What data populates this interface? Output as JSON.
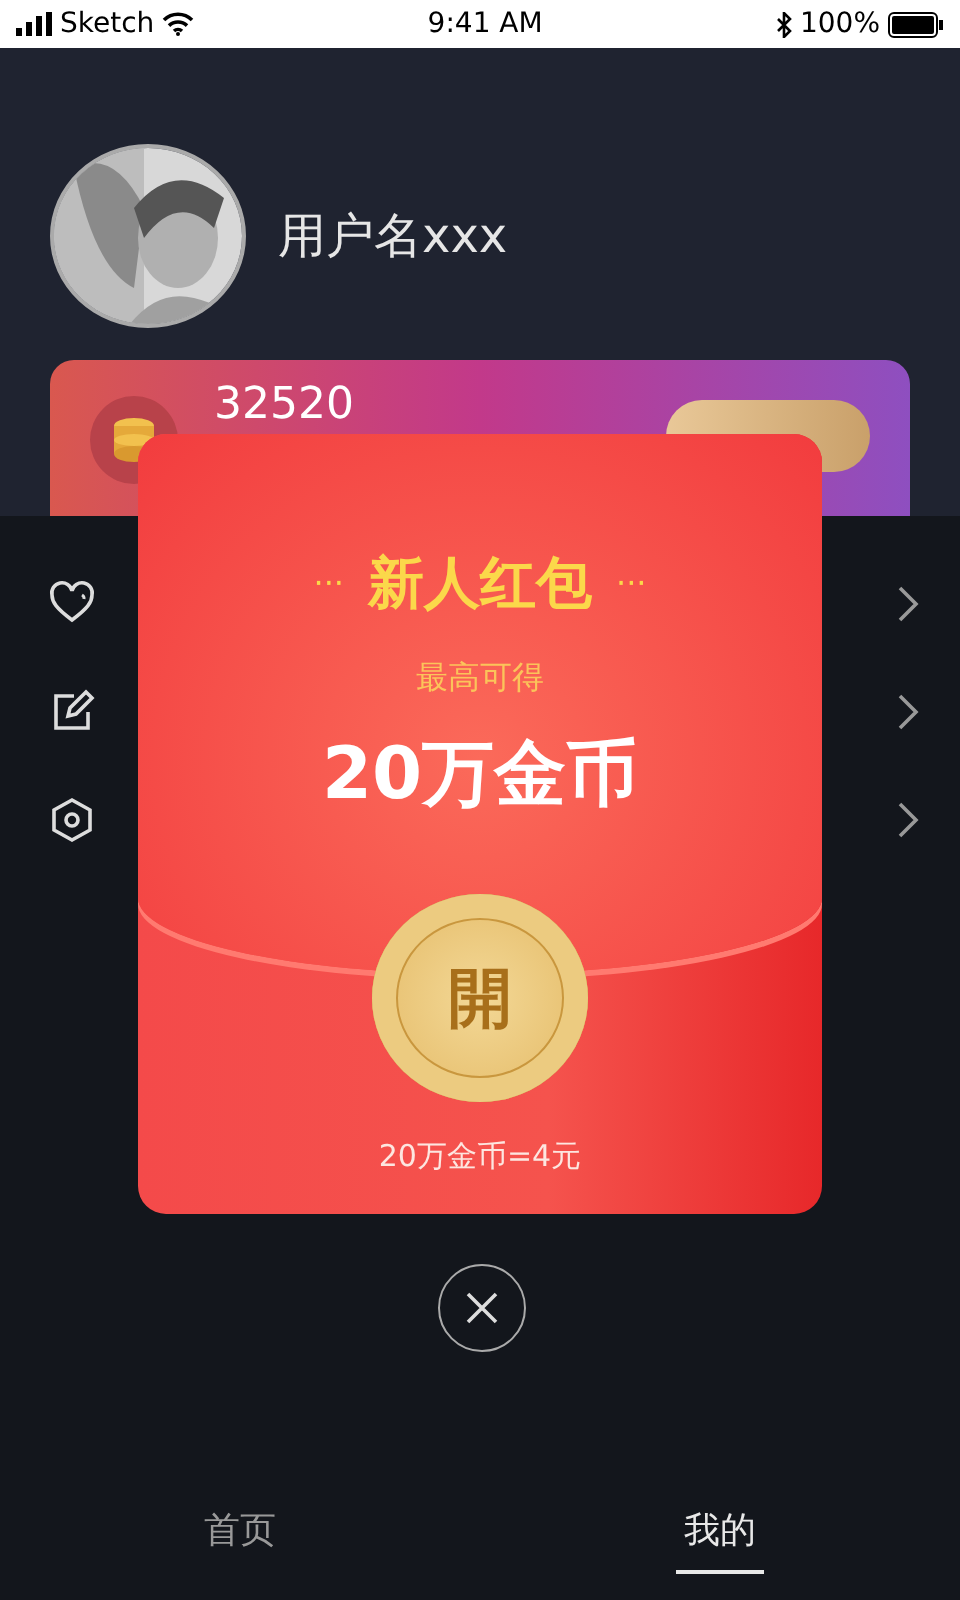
{
  "status_bar": {
    "carrier": "Sketch",
    "time": "9:41 AM",
    "battery": "100%"
  },
  "profile": {
    "username": "用户名xxx"
  },
  "coin_card": {
    "amount": "32520"
  },
  "red_packet": {
    "dots_left": "···",
    "title": "新人红包",
    "dots_right": "···",
    "subtitle": "最高可得",
    "amount": "20万金币",
    "open_button": "開",
    "note": "20万金币=4元"
  },
  "tabs": [
    {
      "label": "首页",
      "selected": false
    },
    {
      "label": "我的",
      "selected": true
    }
  ]
}
